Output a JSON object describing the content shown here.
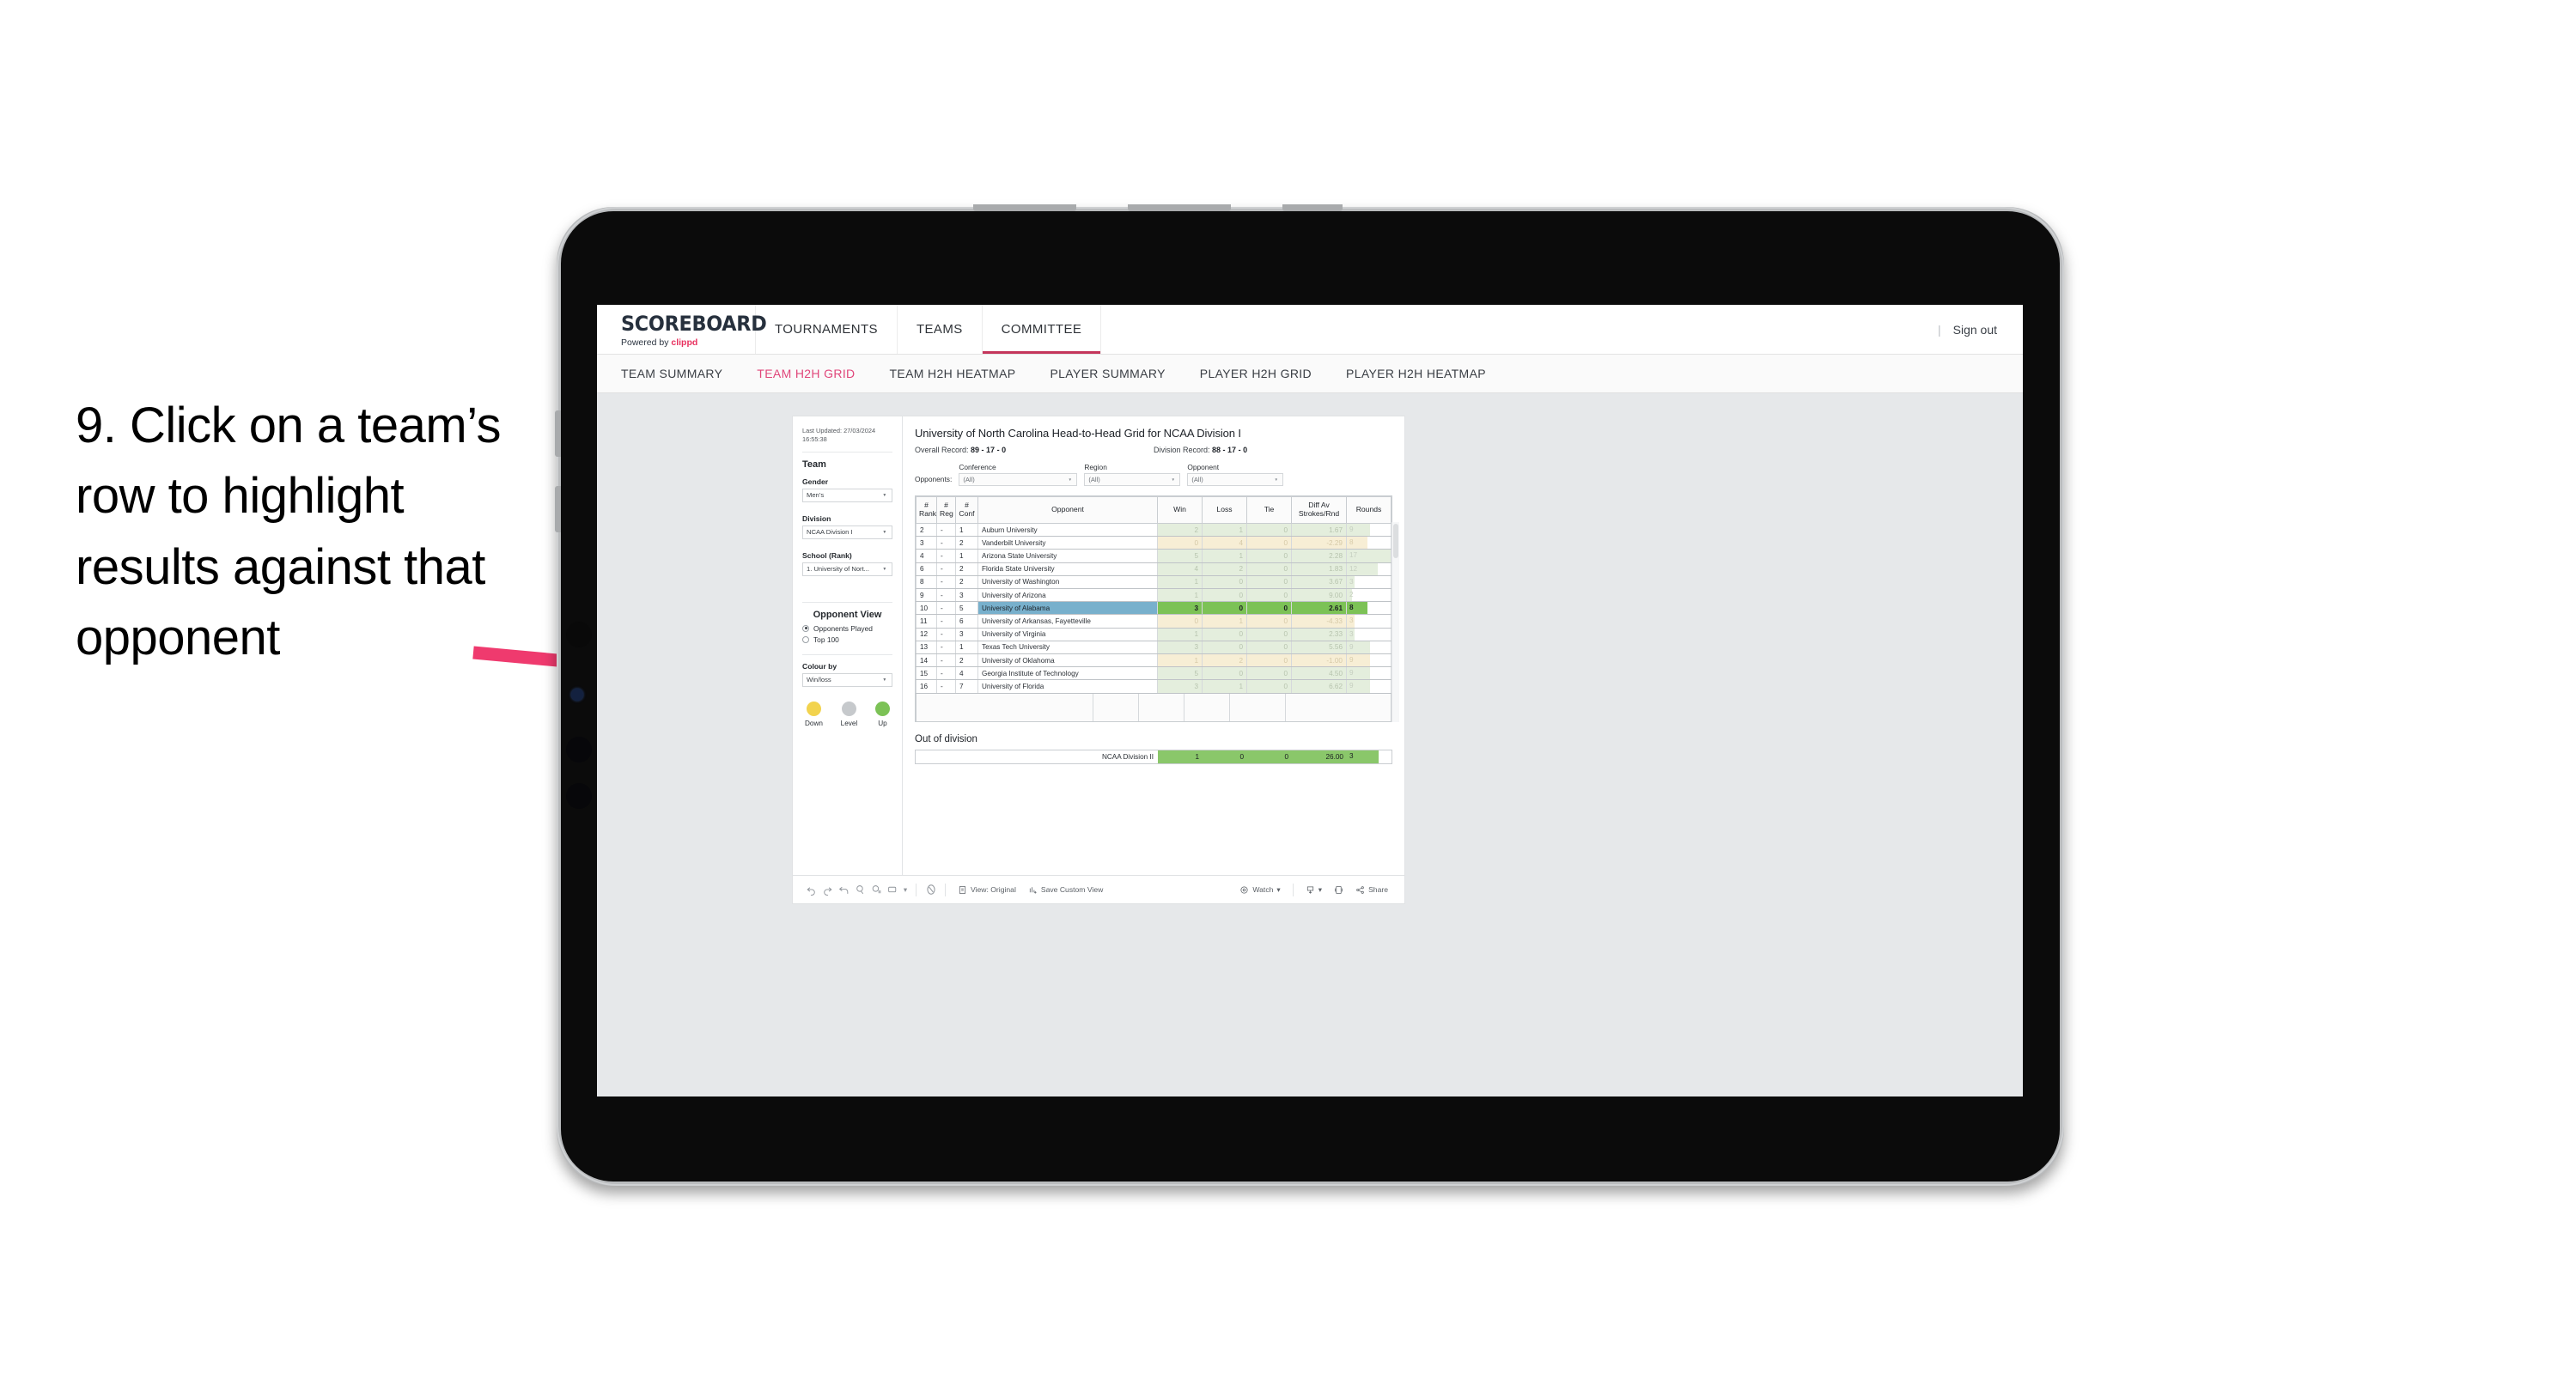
{
  "annotation": {
    "text": "9. Click on a team’s row to highlight results against that opponent",
    "arrow_color": "#ef3a6e"
  },
  "topnav": {
    "brand_title": "SCOREBOARD",
    "brand_sub_prefix": "Powered by ",
    "brand_sub_name": "clippd",
    "items": [
      {
        "label": "TOURNAMENTS",
        "active": false
      },
      {
        "label": "TEAMS",
        "active": false
      },
      {
        "label": "COMMITTEE",
        "active": true
      }
    ],
    "divider": "|",
    "sign_out": "Sign out"
  },
  "subnav": {
    "items": [
      {
        "label": "TEAM SUMMARY",
        "active": false
      },
      {
        "label": "TEAM H2H GRID",
        "active": true
      },
      {
        "label": "TEAM H2H HEATMAP",
        "active": false
      },
      {
        "label": "PLAYER SUMMARY",
        "active": false
      },
      {
        "label": "PLAYER H2H GRID",
        "active": false
      },
      {
        "label": "PLAYER H2H HEATMAP",
        "active": false
      }
    ]
  },
  "pane": {
    "last_updated_line1": "Last Updated: 27/03/2024",
    "last_updated_line2": "16:55:38",
    "team_heading": "Team",
    "gender_label": "Gender",
    "gender_value": "Men’s",
    "division_label": "Division",
    "division_value": "NCAA Division I",
    "school_label": "School (Rank)",
    "school_value": "1. University of Nort...",
    "opponent_view_heading": "Opponent View",
    "opponent_view_options": [
      {
        "label": "Opponents Played",
        "selected": true
      },
      {
        "label": "Top 100",
        "selected": false
      }
    ],
    "colour_by_label": "Colour by",
    "colour_by_value": "Win/loss",
    "legend": [
      {
        "label": "Down",
        "color": "#f2d34e"
      },
      {
        "label": "Level",
        "color": "#c6c9cc"
      },
      {
        "label": "Up",
        "color": "#7cc256"
      }
    ]
  },
  "viz": {
    "title": "University of North Carolina Head-to-Head Grid for NCAA Division I",
    "overall_record_label": "Overall Record:",
    "overall_record_value": "89 - 17 - 0",
    "division_record_label": "Division Record:",
    "division_record_value": "88 - 17 - 0",
    "opponents_label": "Opponents:",
    "filters": [
      {
        "label": "Conference",
        "value": "(All)"
      },
      {
        "label": "Region",
        "value": "(All)"
      },
      {
        "label": "Opponent",
        "value": "(All)"
      }
    ],
    "out_of_division_title": "Out of division"
  },
  "chart_data": {
    "type": "table",
    "title": "University of North Carolina Head-to-Head Grid for NCAA Division I",
    "columns": [
      "# Rank",
      "# Reg",
      "# Conf",
      "Opponent",
      "Win",
      "Loss",
      "Tie",
      "Diff Av Strokes/Rnd",
      "Rounds"
    ],
    "rounds_max": 17,
    "rows": [
      {
        "rank": "2",
        "reg": "-",
        "conf": "1",
        "opponent": "Auburn University",
        "win": "2",
        "loss": "1",
        "tie": "0",
        "diff": "1.67",
        "rounds": "9",
        "state": "win",
        "selected": false
      },
      {
        "rank": "3",
        "reg": "-",
        "conf": "2",
        "opponent": "Vanderbilt University",
        "win": "0",
        "loss": "4",
        "tie": "0",
        "diff": "-2.29",
        "rounds": "8",
        "state": "loss",
        "selected": false
      },
      {
        "rank": "4",
        "reg": "-",
        "conf": "1",
        "opponent": "Arizona State University",
        "win": "5",
        "loss": "1",
        "tie": "0",
        "diff": "2.28",
        "rounds": "17",
        "state": "win",
        "selected": false
      },
      {
        "rank": "6",
        "reg": "-",
        "conf": "2",
        "opponent": "Florida State University",
        "win": "4",
        "loss": "2",
        "tie": "0",
        "diff": "1.83",
        "rounds": "12",
        "state": "win",
        "selected": false
      },
      {
        "rank": "8",
        "reg": "-",
        "conf": "2",
        "opponent": "University of Washington",
        "win": "1",
        "loss": "0",
        "tie": "0",
        "diff": "3.67",
        "rounds": "3",
        "state": "win",
        "selected": false
      },
      {
        "rank": "9",
        "reg": "-",
        "conf": "3",
        "opponent": "University of Arizona",
        "win": "1",
        "loss": "0",
        "tie": "0",
        "diff": "9.00",
        "rounds": "2",
        "state": "win",
        "selected": false
      },
      {
        "rank": "10",
        "reg": "-",
        "conf": "5",
        "opponent": "University of Alabama",
        "win": "3",
        "loss": "0",
        "tie": "0",
        "diff": "2.61",
        "rounds": "8",
        "state": "selected",
        "selected": true
      },
      {
        "rank": "11",
        "reg": "-",
        "conf": "6",
        "opponent": "University of Arkansas, Fayetteville",
        "win": "0",
        "loss": "1",
        "tie": "0",
        "diff": "-4.33",
        "rounds": "3",
        "state": "loss",
        "selected": false
      },
      {
        "rank": "12",
        "reg": "-",
        "conf": "3",
        "opponent": "University of Virginia",
        "win": "1",
        "loss": "0",
        "tie": "0",
        "diff": "2.33",
        "rounds": "3",
        "state": "win",
        "selected": false
      },
      {
        "rank": "13",
        "reg": "-",
        "conf": "1",
        "opponent": "Texas Tech University",
        "win": "3",
        "loss": "0",
        "tie": "0",
        "diff": "5.56",
        "rounds": "9",
        "state": "win",
        "selected": false
      },
      {
        "rank": "14",
        "reg": "-",
        "conf": "2",
        "opponent": "University of Oklahoma",
        "win": "1",
        "loss": "2",
        "tie": "0",
        "diff": "-1.00",
        "rounds": "9",
        "state": "loss",
        "selected": false
      },
      {
        "rank": "15",
        "reg": "-",
        "conf": "4",
        "opponent": "Georgia Institute of Technology",
        "win": "5",
        "loss": "0",
        "tie": "0",
        "diff": "4.50",
        "rounds": "9",
        "state": "win",
        "selected": false
      },
      {
        "rank": "16",
        "reg": "-",
        "conf": "7",
        "opponent": "University of Florida",
        "win": "3",
        "loss": "1",
        "tie": "0",
        "diff": "6.62",
        "rounds": "9",
        "state": "win",
        "selected": false
      }
    ],
    "out_of_division": [
      {
        "label": "NCAA Division II",
        "win": "1",
        "loss": "0",
        "tie": "0",
        "diff": "26.00",
        "rounds": "3"
      }
    ]
  },
  "toolbar": {
    "undo": "undo-icon",
    "redo": "redo-icon",
    "revert": "revert-icon",
    "refresh": "refresh-icon",
    "pause": "pause-icon",
    "view_original": "View: Original",
    "save_custom_view": "Save Custom View",
    "watch": "Watch",
    "share": "Share"
  }
}
